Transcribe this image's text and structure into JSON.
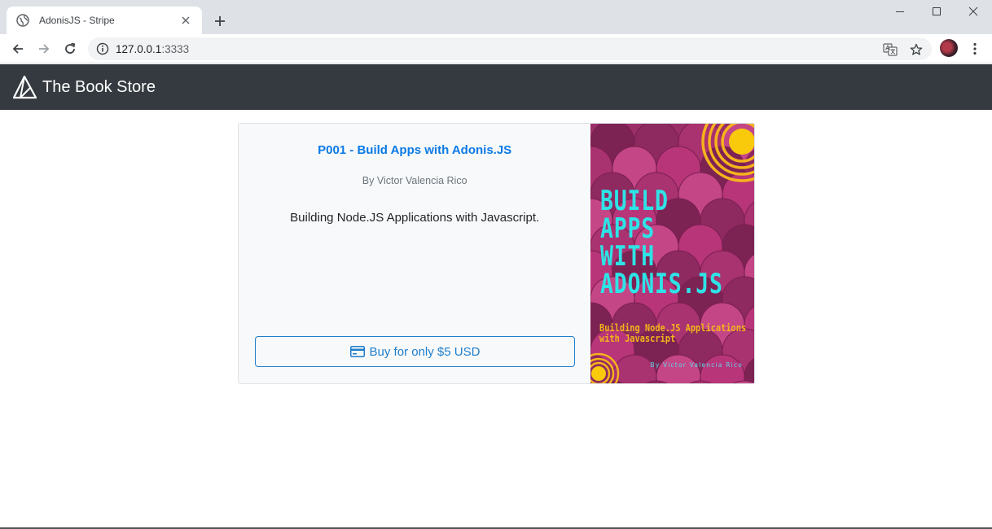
{
  "browser": {
    "tab_title": "AdonisJS - Stripe",
    "url_host": "127.0.0.1",
    "url_port": ":3333"
  },
  "navbar": {
    "brand": "The Book Store"
  },
  "product": {
    "title": "P001 - Build Apps with Adonis.JS",
    "author": "By Victor Valencia Rico",
    "description": "Building Node.JS Applications with Javascript.",
    "buy_label": "Buy for only $5 USD",
    "cover": {
      "title": "BUILD\nAPPS\nWITH\nADONIS.JS",
      "subtitle": "Building Node.JS Applications\nwith Javascript",
      "author": "By Victor Valencia Rico"
    }
  },
  "colors": {
    "navbar_bg": "#343a40",
    "link_blue": "#0b7ae6",
    "button_blue": "#1f7ecb",
    "cover_bg": "#9a2f6a",
    "cover_title": "#2ee3e6",
    "cover_subtitle": "#f3b51b"
  }
}
